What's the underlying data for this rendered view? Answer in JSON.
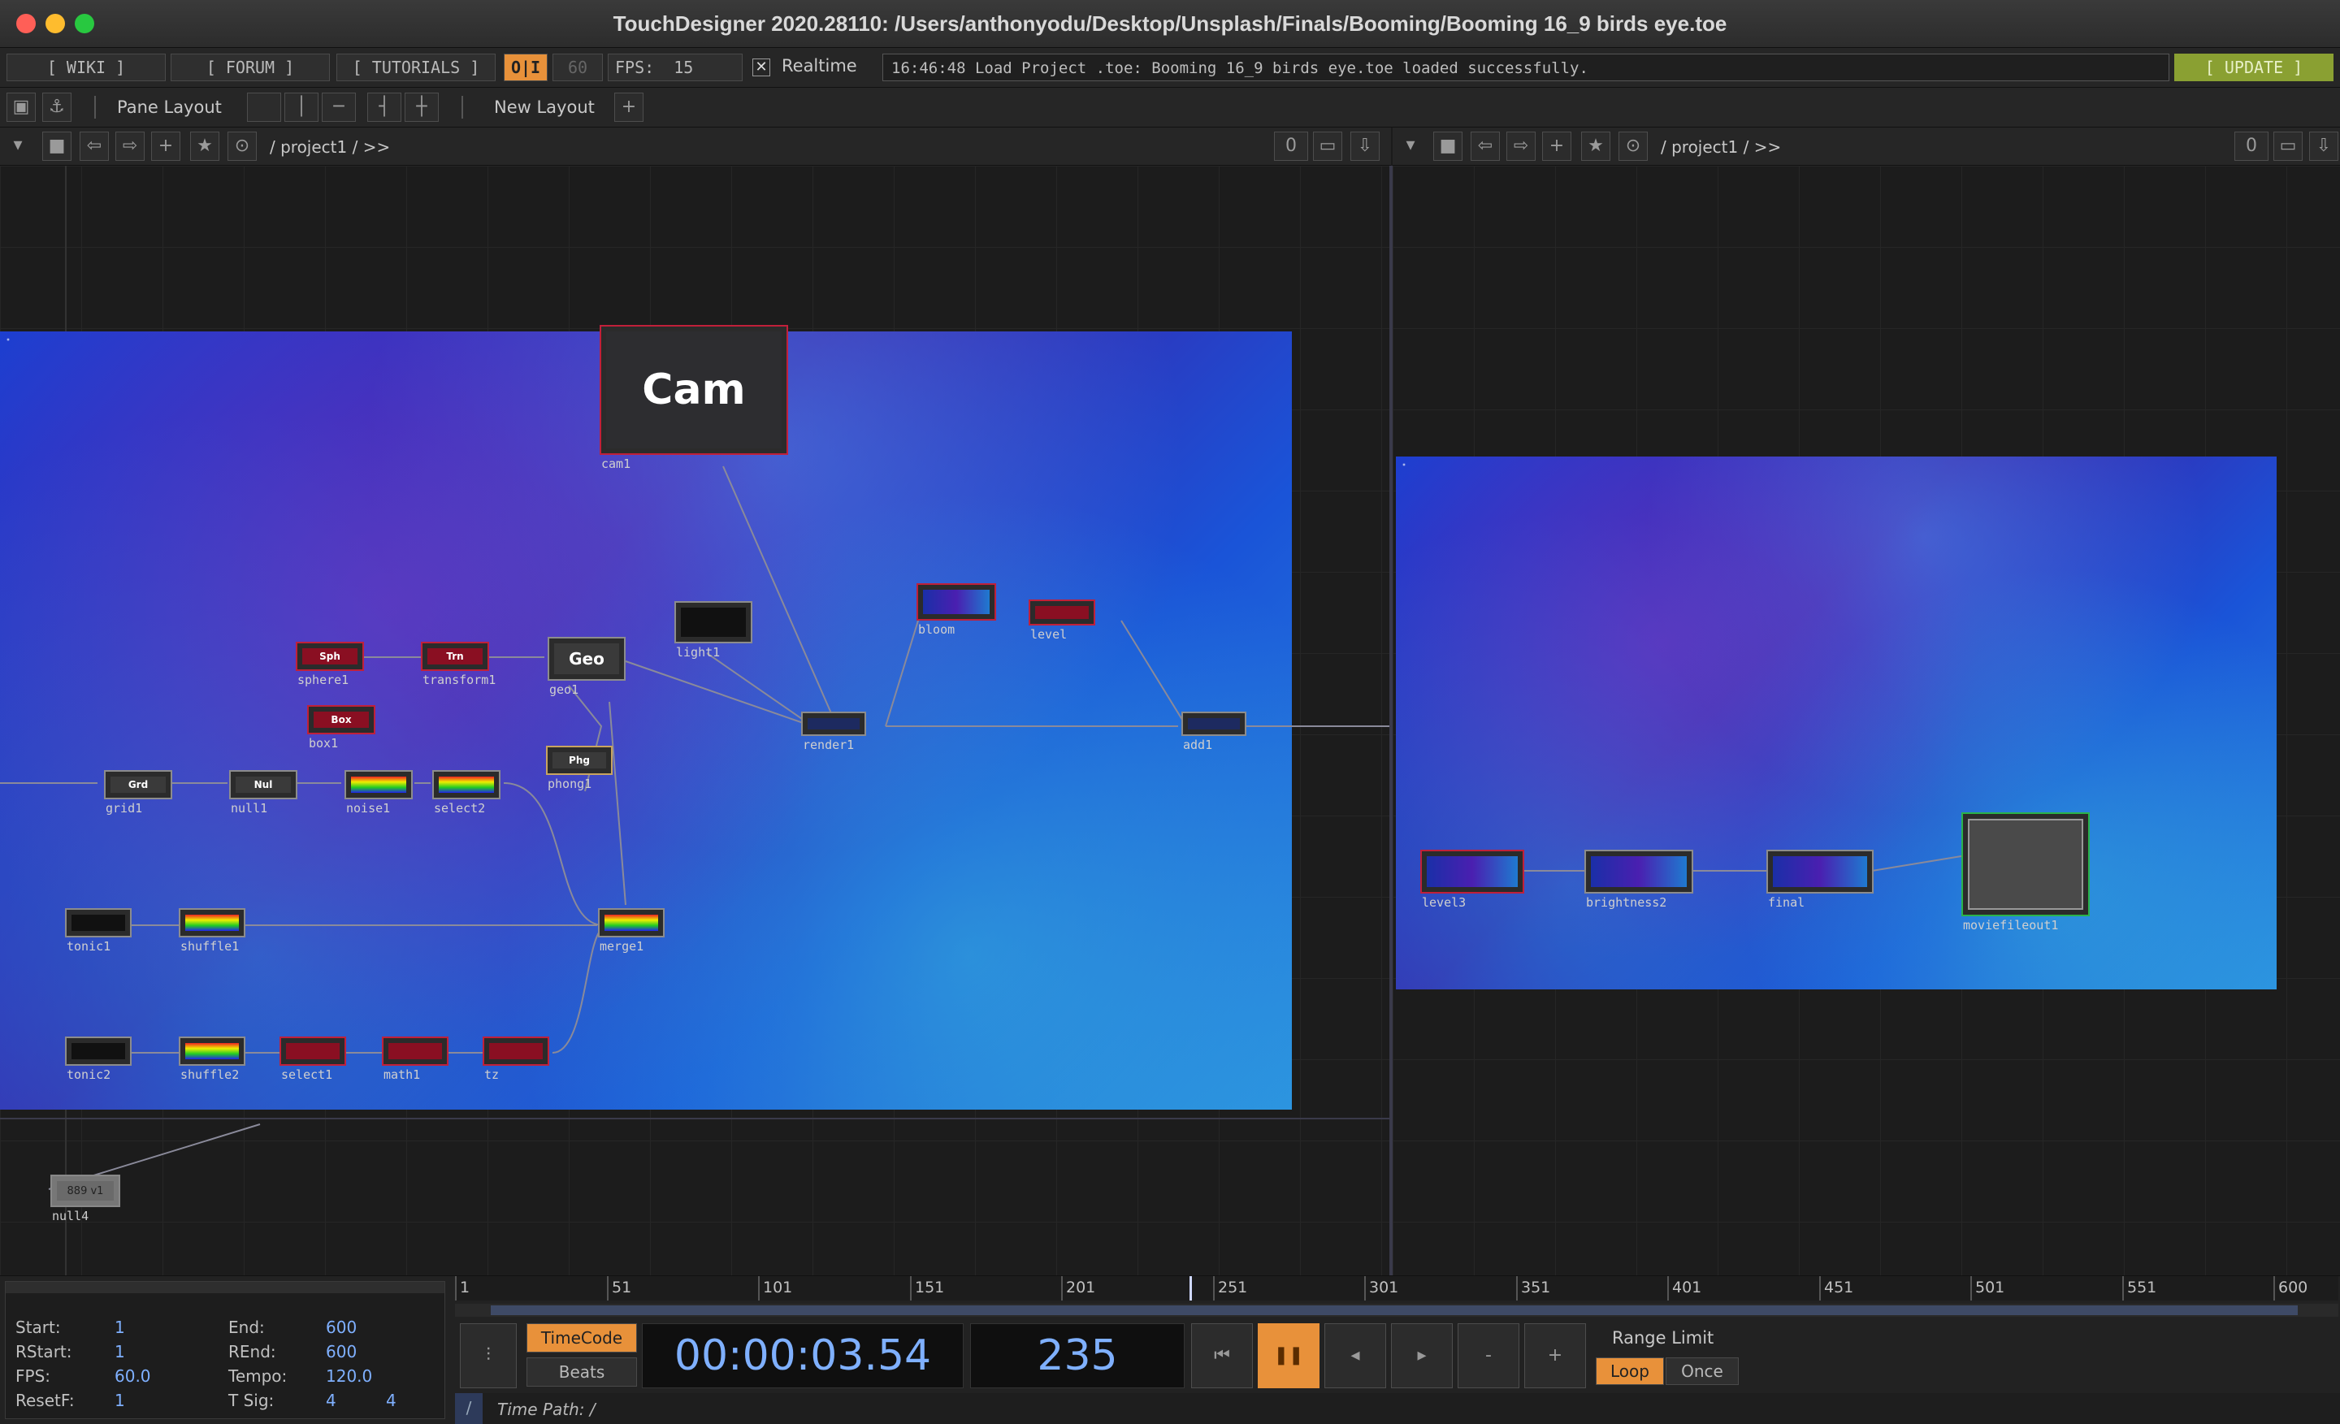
{
  "window": {
    "title": "TouchDesigner 2020.28110: /Users/anthonyodu/Desktop/Unsplash/Finals/Booming/Booming 16_9 birds eye.toe"
  },
  "toolbar": {
    "wiki": "[ WIKI ]",
    "forum": "[ FORUM ]",
    "tutorials": "[ TUTORIALS ]",
    "oi": "O|I",
    "fps_target": "60",
    "fps_label": "FPS:",
    "fps_value": "15",
    "realtime_label": "Realtime",
    "realtime_checked": true,
    "message": "16:46:48 Load Project .toe: Booming 16_9 birds eye.toe loaded successfully.",
    "update": "[ UPDATE ]"
  },
  "layout_bar": {
    "pane_layout": "Pane Layout",
    "new_layout": "New Layout"
  },
  "left_pane": {
    "path": "/ project1 / >>",
    "counter": "0",
    "cam_label": "Cam",
    "nodes": {
      "cam1": "cam1",
      "light1": "light1",
      "bloom": "bloom",
      "level": "level",
      "geo_title": "Geo",
      "geo1": "geo1",
      "sphere_title": "Sph",
      "sphere1": "sphere1",
      "transform_title": "Trn",
      "transform1": "transform1",
      "box_title": "Box",
      "box1": "box1",
      "phong_title": "Phg",
      "phong1": "phong1",
      "render1": "render1",
      "add1": "add1",
      "grid_title": "Grd",
      "grid1": "grid1",
      "null_title": "Nul",
      "null1": "null1",
      "noise1": "noise1",
      "select2": "select2",
      "tonic1": "tonic1",
      "shuffle1": "shuffle1",
      "merge1": "merge1",
      "tonic2": "tonic2",
      "shuffle2": "shuffle2",
      "select1": "select1",
      "math1": "math1",
      "tz1": "tz",
      "null4": "null4",
      "null4_value": "889  v1"
    }
  },
  "right_pane": {
    "path": "/ project1 / >>",
    "counter": "0",
    "nodes": {
      "level3": "level3",
      "bright": "brightness2",
      "final": "final",
      "movie": "moviefileout1"
    }
  },
  "timeline": {
    "ticks": [
      "1",
      "51",
      "101",
      "151",
      "201",
      "251",
      "301",
      "351",
      "401",
      "451",
      "501",
      "551",
      "600"
    ],
    "current_frame_fraction": 0.39,
    "start_label": "Start:",
    "start": "1",
    "end_label": "End:",
    "end": "600",
    "rstart_label": "RStart:",
    "rstart": "1",
    "rend_label": "REnd:",
    "rend": "600",
    "fps_label": "FPS:",
    "fps": "60.0",
    "tempo_label": "Tempo:",
    "tempo": "120.0",
    "resetf_label": "ResetF:",
    "resetf": "1",
    "tsig_label": "T Sig:",
    "tsig_a": "4",
    "tsig_b": "4",
    "timecode_btn": "TimeCode",
    "beats_btn": "Beats",
    "timecode": "00:00:03.54",
    "frame": "235",
    "range_limit": "Range Limit",
    "loop": "Loop",
    "once": "Once",
    "time_path_label": "Time Path: /",
    "slash": "/",
    "minus": "-",
    "plus": "+"
  },
  "colors": {
    "accent_orange": "#e8913a",
    "timecode_blue": "#7fb0ff",
    "update_green": "#8aa032"
  }
}
